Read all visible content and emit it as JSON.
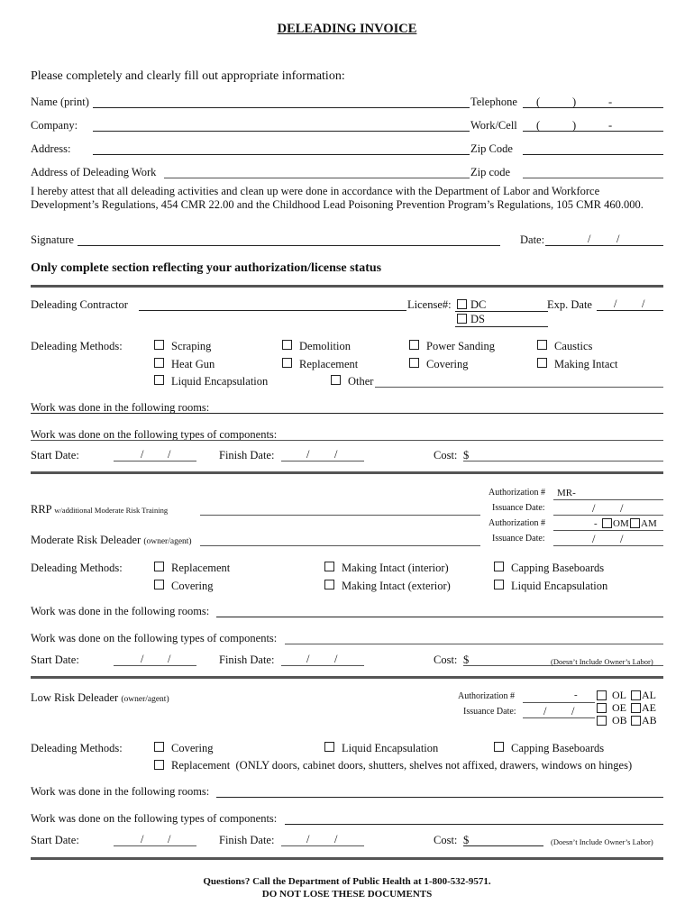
{
  "title": "DELEADING INVOICE",
  "intro": "Please completely and clearly fill out appropriate information:",
  "contact": {
    "name_label": "Name (print)",
    "telephone_label": "Telephone",
    "company_label": "Company:",
    "workcell_label": "Work/Cell",
    "address_label": "Address:",
    "zip_label": "Zip Code",
    "deleading_address_label": "Address of Deleading Work",
    "zip2_label": "Zip code",
    "phone_open": "(",
    "phone_close": ")",
    "phone_dash": "-"
  },
  "attestation": {
    "line1": "I hereby attest that all deleading activities and clean up were done in accordance with the Department of Labor and Workforce",
    "line2": "Development’s Regulations, 454 CMR 22.00 and the Childhood Lead Poisoning Prevention Program’s Regulations, 105 CMR 460.000."
  },
  "signature": {
    "signature_label": "Signature",
    "date_label": "Date:",
    "slash": "/"
  },
  "section_heading": "Only complete section reflecting your authorization/license status",
  "contractor": {
    "label": "Deleading Contractor",
    "license_label": "License#:",
    "license_options": [
      "DC",
      "DS"
    ],
    "exp_label": "Exp. Date",
    "methods_label": "Deleading Methods:",
    "methods": [
      "Scraping",
      "Demolition",
      "Power Sanding",
      "Caustics",
      "Heat Gun",
      "Replacement",
      "Covering",
      "Making Intact",
      "Liquid Encapsulation",
      "Other"
    ],
    "rooms_label": "Work was done in the following rooms:",
    "components_label": "Work was done on the following types of components:",
    "start_label": "Start Date:",
    "finish_label": "Finish Date:",
    "cost_label": "Cost:",
    "currency": "$"
  },
  "moderate": {
    "rrp_label": "RRP",
    "rrp_sub": "w/additional Moderate Risk Training",
    "mrd_label": "Moderate Risk Deleader",
    "mrd_sub": "(owner/agent)",
    "auth_label": "Authorization #",
    "auth_prefix": "MR-",
    "issuance_label": "Issuance Date:",
    "auth2_dash": "-",
    "auth2_options": [
      "OM",
      "AM"
    ],
    "methods_label": "Deleading Methods:",
    "methods": [
      "Replacement",
      "Making Intact (interior)",
      "Capping Baseboards",
      "Covering",
      "Making Intact (exterior)",
      "Liquid Encapsulation"
    ],
    "rooms_label": "Work was done in the following rooms:",
    "components_label": "Work was done on the following types of components:",
    "start_label": "Start Date:",
    "finish_label": "Finish Date:",
    "cost_label": "Cost:",
    "currency": "$",
    "cost_note": "(Doesn’t Include Owner’s Labor)"
  },
  "low": {
    "label": "Low Risk Deleader",
    "sub": "(owner/agent)",
    "auth_label": "Authorization #",
    "auth_dash": "-",
    "issuance_label": "Issuance Date:",
    "options": [
      "OL",
      "AL",
      "OE",
      "AE",
      "OB",
      "AB"
    ],
    "methods_label": "Deleading Methods:",
    "methods": [
      "Covering",
      "Liquid Encapsulation",
      "Capping Baseboards"
    ],
    "replacement_label": "Replacement",
    "replacement_note": "(ONLY doors, cabinet doors, shutters, shelves not affixed, drawers, windows on hinges)",
    "rooms_label": "Work was done in the following rooms:",
    "components_label": "Work was done on the following types of components:",
    "start_label": "Start Date:",
    "finish_label": "Finish Date:",
    "cost_label": "Cost:",
    "currency": "$",
    "cost_note": "(Doesn’t Include Owner’s Labor)"
  },
  "footer": {
    "line1": "Questions? Call the Department of Public Health at 1-800-532-9571.",
    "line2": "DO NOT LOSE THESE DOCUMENTS"
  }
}
